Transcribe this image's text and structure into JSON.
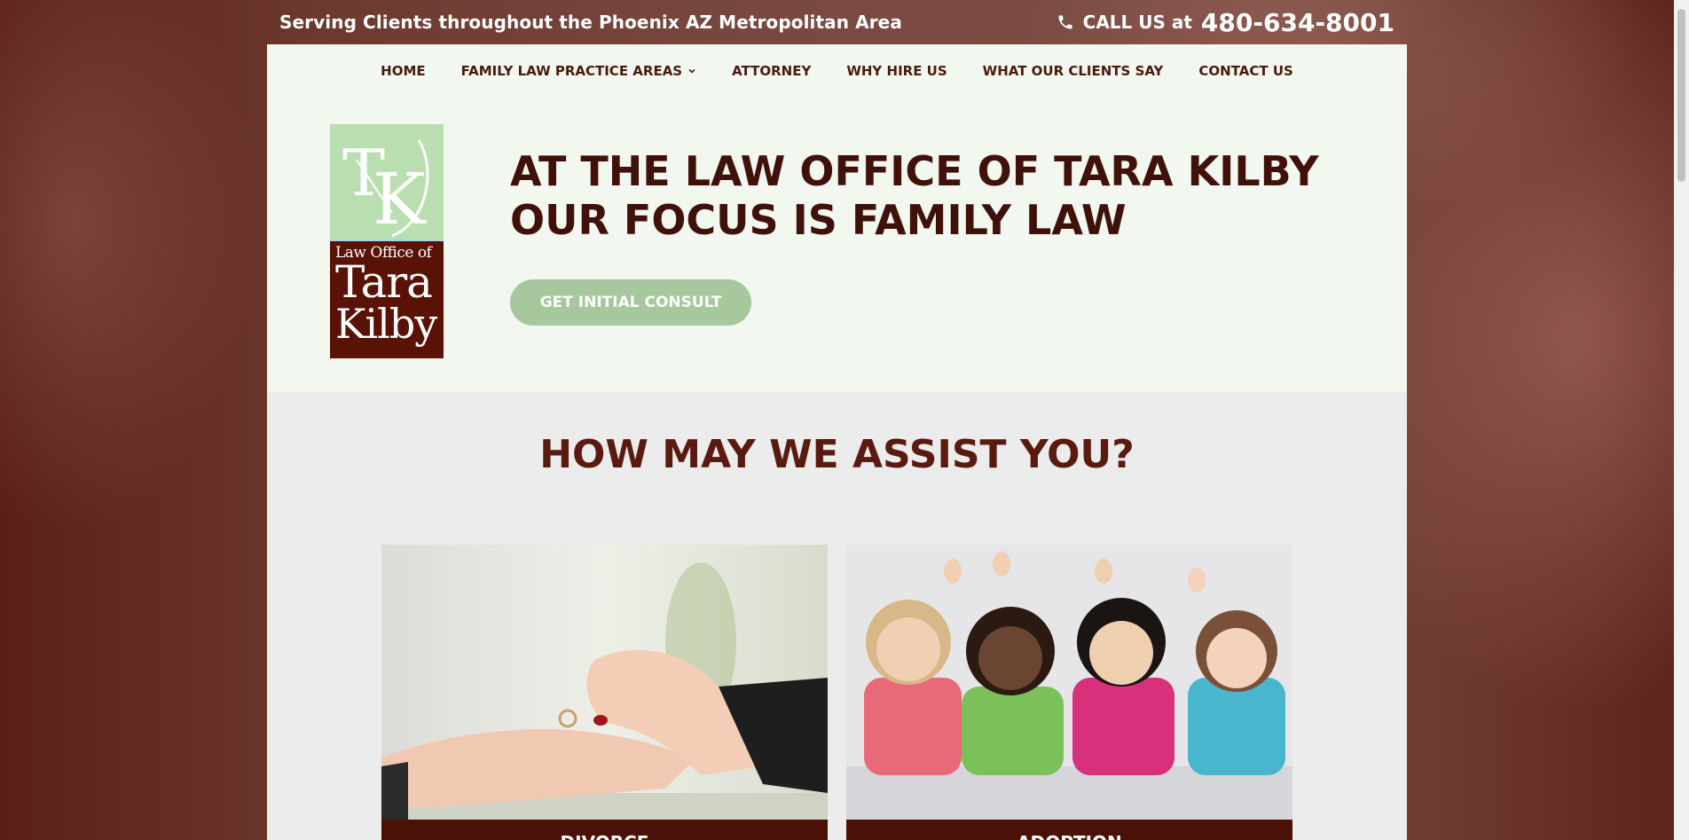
{
  "topbar": {
    "tagline": "Serving Clients throughout the Phoenix AZ Metropolitan Area",
    "call_label": "CALL US at",
    "phone": "480-634-8001",
    "phone_icon": "phone-icon"
  },
  "nav": {
    "items": [
      {
        "label": "HOME"
      },
      {
        "label": "FAMILY LAW PRACTICE AREAS",
        "has_dropdown": true
      },
      {
        "label": "ATTORNEY"
      },
      {
        "label": "WHY HIRE US"
      },
      {
        "label": "WHAT OUR CLIENTS SAY"
      },
      {
        "label": "CONTACT US"
      }
    ]
  },
  "logo": {
    "monogram": "TK",
    "line1": "Law Office of",
    "line2": "Tara",
    "line3": "Kilby"
  },
  "hero": {
    "headline": "AT THE LAW OFFICE OF TARA KILBY OUR FOCUS IS FAMILY LAW",
    "cta_label": "GET INITIAL CONSULT"
  },
  "assist": {
    "heading": "HOW MAY WE ASSIST YOU?",
    "cards": [
      {
        "label": "DIVORCE"
      },
      {
        "label": "ADOPTION"
      }
    ]
  },
  "colors": {
    "accent_dark": "#40110a",
    "accent_green": "#a6c89c",
    "hero_bg": "#f2f7ef",
    "section_bg": "#ececec"
  }
}
